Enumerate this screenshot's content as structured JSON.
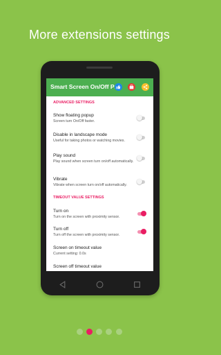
{
  "headline": "More extensions settings",
  "app": {
    "title": "Smart Screen On/Off Pro",
    "accent": "#4caf50",
    "icons": [
      "thumbs-up-icon",
      "store-icon",
      "share-icon"
    ]
  },
  "sections": [
    {
      "header": "ADVANCED SETTINGS",
      "rows": [
        {
          "title": "Show floating popup",
          "subtitle": "Screen turn On/Off faster.",
          "toggle": false
        },
        {
          "title": "Disable in landscape mode",
          "subtitle": "Useful for taking photos or watching movies.",
          "toggle": false
        },
        {
          "title": "Play sound",
          "subtitle": "Play sound when screen turn on/off automatically.",
          "toggle": false
        },
        {
          "title": "Vibrate",
          "subtitle": "Vibrate when screen turn on/off automatically.",
          "toggle": false
        }
      ]
    },
    {
      "header": "TIMEOUT VALUE SETTINGS",
      "rows": [
        {
          "title": "Turn on",
          "subtitle": "Turn on the screen with proximity sensor.",
          "toggle": true
        },
        {
          "title": "Turn off",
          "subtitle": "Turn off the screen with proximity sensor.",
          "toggle": true
        },
        {
          "title": "Screen on timeout value",
          "subtitle": "Current setting: 0.0s"
        },
        {
          "title": "Screen off timeout value",
          "subtitle": ""
        }
      ]
    }
  ],
  "pager": {
    "count": 5,
    "active_index": 1
  }
}
